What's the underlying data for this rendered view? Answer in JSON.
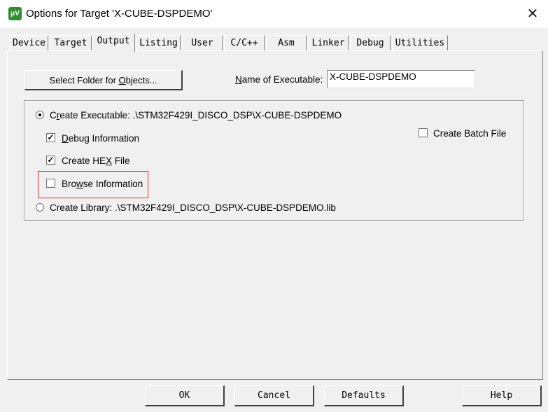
{
  "window": {
    "title": "Options for Target 'X-CUBE-DSPDEMO'",
    "app_icon": "keil-uvision-icon",
    "close_glyph": "✕"
  },
  "tabs": [
    {
      "label": "Device"
    },
    {
      "label": "Target"
    },
    {
      "label": "Output",
      "active": true
    },
    {
      "label": "Listing"
    },
    {
      "label": "User"
    },
    {
      "label": "C/C++"
    },
    {
      "label": "Asm"
    },
    {
      "label": "Linker"
    },
    {
      "label": "Debug"
    },
    {
      "label": "Utilities"
    }
  ],
  "output": {
    "select_folder_label_pre": "Select Folder for ",
    "select_folder_label_u": "O",
    "select_folder_label_post": "bjects...",
    "name_exec_label_u": "N",
    "name_exec_label_post": "ame of Executable:",
    "name_exec_value": "X-CUBE-DSPDEMO",
    "create_exec_pre": "C",
    "create_exec_u": "r",
    "create_exec_post": "eate Executable:  .\\STM32F429I_DISCO_DSP\\X-CUBE-DSPDEMO",
    "create_exec_checked": true,
    "debug_info_u": "D",
    "debug_info_post": "ebug Information",
    "debug_info_checked": true,
    "hex_pre": "Create HE",
    "hex_u": "X",
    "hex_post": " File",
    "hex_checked": true,
    "browse_pre": "Bro",
    "browse_u": "w",
    "browse_post": "se Information",
    "browse_checked": false,
    "create_lib_label": "Create Library:  .\\STM32F429I_DISCO_DSP\\X-CUBE-DSPDEMO.lib",
    "create_lib_checked": false,
    "batch_label": "Create Batch File",
    "batch_checked": false
  },
  "buttons": {
    "ok": "OK",
    "cancel": "Cancel",
    "defaults": "Defaults",
    "help": "Help"
  },
  "colors": {
    "highlight_border": "#d93030",
    "dialog_bg": "#f0f0f0"
  }
}
